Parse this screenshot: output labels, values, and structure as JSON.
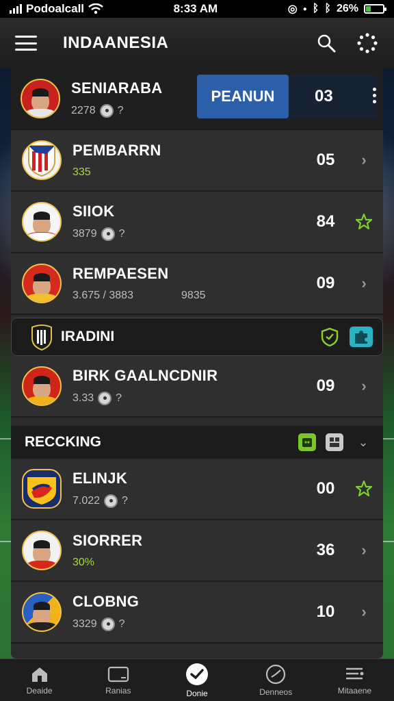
{
  "status_bar": {
    "carrier": "Podoalcall",
    "time": "8:33 AM",
    "battery": "26%"
  },
  "header": {
    "title": "INDAANESIA"
  },
  "rows_top": [
    {
      "name": "SENIARABA",
      "sub": "2278",
      "ball": "?",
      "button": "PEANUN",
      "score": "03"
    },
    {
      "name": "PEMBARRN",
      "sub": "335",
      "score": "05"
    },
    {
      "name": "SIIOK",
      "sub": "3879",
      "ball": "?",
      "score": "84"
    },
    {
      "name": "REMPAESEN",
      "sub": "3.675 / 3883",
      "extra": "9835",
      "score": "09"
    }
  ],
  "section1": {
    "title": "IRADINI"
  },
  "row_mid": {
    "name": "BIRK GAALNCDNIR",
    "sub": "3.33",
    "ball": "?",
    "score": "09"
  },
  "section2": {
    "title": "RECCKING",
    "chevron": "⌄"
  },
  "rows_bottom": [
    {
      "name": "ELINJK",
      "sub": "7.022",
      "ball": "?",
      "score": "00"
    },
    {
      "name": "SIORRER",
      "sub": "30%",
      "score": "36"
    },
    {
      "name": "CLOBNG",
      "sub": "3329",
      "ball": "?",
      "score": "10"
    }
  ],
  "nav": [
    {
      "label": "Deaide",
      "icon": "home-icon"
    },
    {
      "label": "Ranias",
      "icon": "tablet-icon"
    },
    {
      "label": "Donie",
      "icon": "check-circle-icon"
    },
    {
      "label": "Denneos",
      "icon": "clock-icon"
    },
    {
      "label": "Mitaaene",
      "icon": "menu-lines-icon"
    }
  ],
  "colors": {
    "accent_blue": "#2d5fa8",
    "green": "#a4d93a",
    "panel": "#2f2f2f"
  }
}
